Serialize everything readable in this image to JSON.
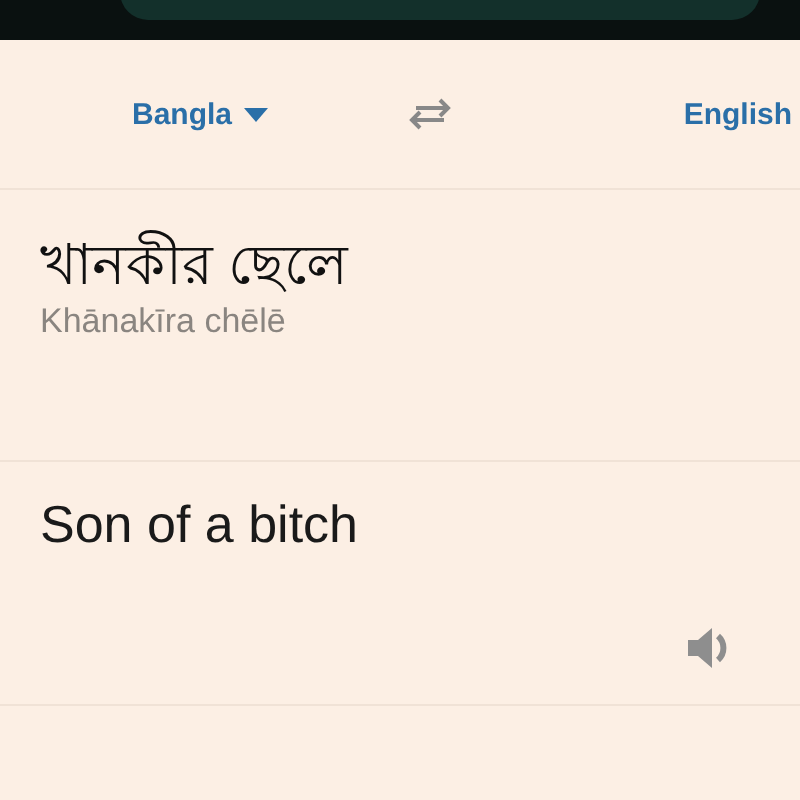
{
  "language_bar": {
    "source_language": "Bangla",
    "target_language": "English"
  },
  "source": {
    "text": "খানকীর ছেলে",
    "transliteration": "Khānakīra chēlē"
  },
  "translation": {
    "text": "Son of a bitch"
  }
}
